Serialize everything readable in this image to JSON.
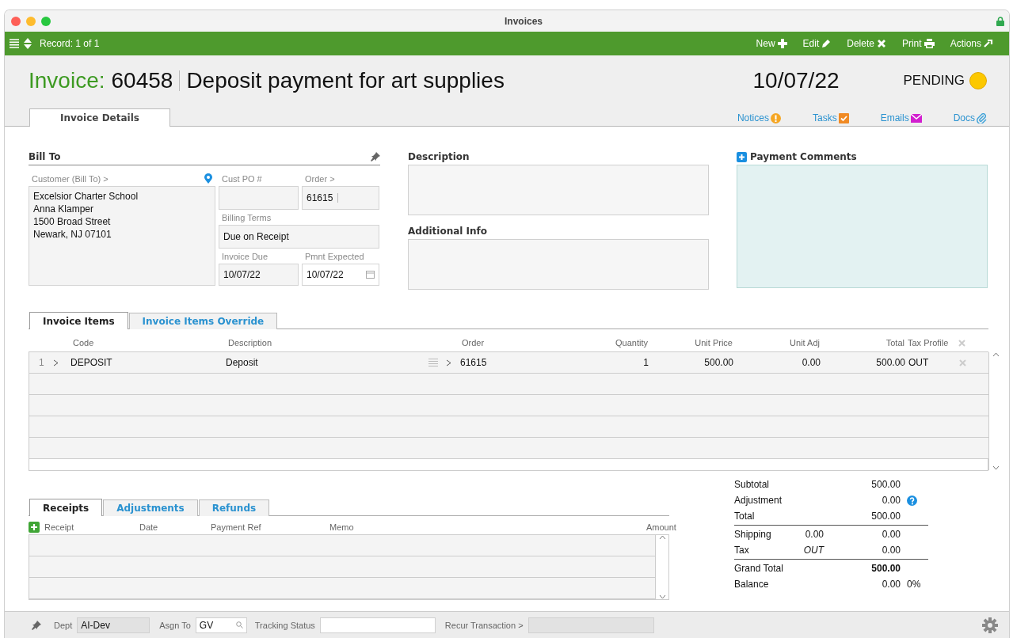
{
  "window": {
    "title": "Invoices"
  },
  "toolbar": {
    "record": "Record: 1 of 1",
    "actions": [
      {
        "label": "New",
        "kind": "new"
      },
      {
        "label": "Edit",
        "kind": "edit"
      },
      {
        "label": "Delete",
        "kind": "delete"
      },
      {
        "label": "Print",
        "kind": "print"
      },
      {
        "label": "Actions",
        "kind": "actions"
      }
    ]
  },
  "header": {
    "label": "Invoice:",
    "number": "60458",
    "title": "Deposit payment for art supplies",
    "date": "10/07/22",
    "status": "PENDING"
  },
  "tabs": [
    {
      "label": "Invoice Details",
      "selected": true
    }
  ],
  "links": [
    {
      "label": "Notices",
      "kind": "notices"
    },
    {
      "label": "Tasks",
      "kind": "tasks"
    },
    {
      "label": "Emails",
      "kind": "emails"
    },
    {
      "label": "Docs",
      "kind": "docs"
    }
  ],
  "bill_to": {
    "title": "Bill To",
    "customer_label": "Customer (Bill To) >",
    "customer_lines": [
      "Excelsior Charter School",
      "Anna Klamper",
      "1500 Broad Street",
      "Newark, NJ 07101"
    ],
    "cust_po_label": "Cust PO #",
    "order_label": "Order >",
    "order": "61615",
    "billing_terms_label": "Billing Terms",
    "billing_terms": "Due on Receipt",
    "invoice_due_label": "Invoice Due",
    "invoice_due": "10/07/22",
    "pmnt_expected_label": "Pmnt Expected",
    "pmnt_expected": "10/07/22"
  },
  "description": {
    "title": "Description"
  },
  "additional_info": {
    "title": "Additional Info"
  },
  "payment_comments": {
    "title": "Payment Comments"
  },
  "items_tabs": [
    {
      "label": "Invoice Items",
      "selected": true
    },
    {
      "label": "Invoice Items Override",
      "selected": false
    }
  ],
  "items_table": {
    "columns": [
      "Code",
      "Description",
      "Order",
      "Quantity",
      "Unit Price",
      "Unit Adj",
      "Total",
      "Tax Profile"
    ],
    "rows": [
      {
        "line": "1",
        "code": "DEPOSIT",
        "description": "Deposit",
        "order": "61615",
        "quantity": "1",
        "unit_price": "500.00",
        "unit_adj": "0.00",
        "total": "500.00",
        "tax_profile": "OUT"
      }
    ]
  },
  "payments_tabs": [
    {
      "label": "Receipts",
      "selected": true
    },
    {
      "label": "Adjustments",
      "selected": false
    },
    {
      "label": "Refunds",
      "selected": false
    }
  ],
  "payments_table": {
    "columns": [
      "Receipt",
      "Date",
      "Payment Ref",
      "Memo",
      "Amount"
    ]
  },
  "totals": {
    "groups": [
      [
        {
          "label": "Subtotal",
          "value": "500.00"
        },
        {
          "label": "Adjustment",
          "value": "0.00",
          "kind": "help"
        },
        {
          "label": "Total",
          "value": "500.00"
        }
      ],
      [
        {
          "label": "Shipping",
          "middle": "0.00",
          "value": "0.00"
        },
        {
          "label": "Tax",
          "middle": "OUT",
          "value": "0.00",
          "kind": "italic"
        }
      ],
      [
        {
          "label": "Grand Total",
          "value": "500.00",
          "kind": "bold"
        },
        {
          "label": "Balance",
          "value": "0.00",
          "extra": "0%"
        }
      ]
    ]
  },
  "footer": {
    "dept_label": "Dept",
    "dept": "AI-Dev",
    "asgn_label": "Asgn To",
    "asgn": "GV",
    "tracking_label": "Tracking Status",
    "recur_label": "Recur Transaction >"
  }
}
